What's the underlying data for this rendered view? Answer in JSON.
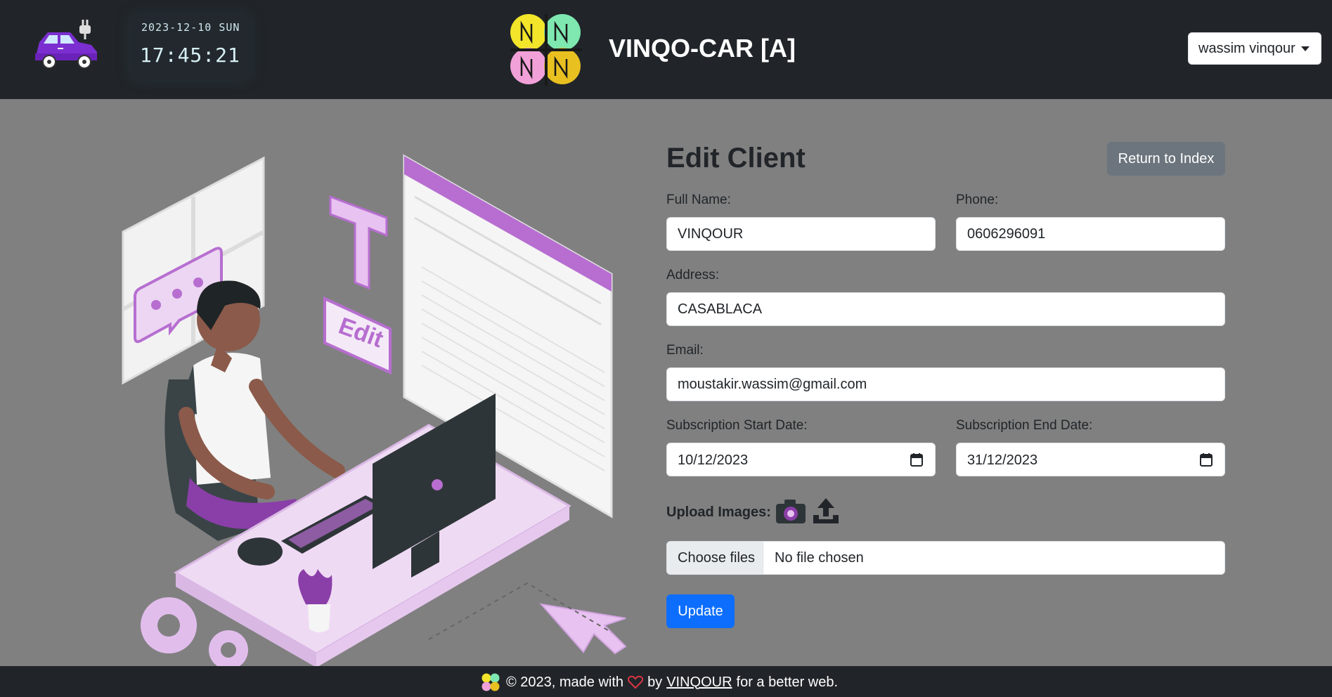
{
  "header": {
    "clock_date": "2023-12-10 SUN",
    "clock_time": "17:45:21",
    "title": "VINQO-CAR [A]",
    "user_menu": "wassim vinqour"
  },
  "form": {
    "title": "Edit Client",
    "return_label": "Return to Index",
    "full_name_label": "Full Name:",
    "full_name_value": "VINQOUR",
    "phone_label": "Phone:",
    "phone_value": "0606296091",
    "address_label": "Address:",
    "address_value": "CASABLACA",
    "email_label": "Email:",
    "email_value": "moustakir.wassim@gmail.com",
    "start_label": "Subscription Start Date:",
    "start_value": "10/12/2023",
    "end_label": "Subscription End Date:",
    "end_value": "31/12/2023",
    "upload_label": "Upload Images:",
    "choose_files": "Choose files",
    "no_file": "No file chosen",
    "update_label": "Update"
  },
  "footer": {
    "pre": "© 2023, made with",
    "by": "by",
    "author": "VINQOUR",
    "post": "for a better web."
  },
  "colors": {
    "header_bg": "#212529",
    "page_bg": "#808080",
    "primary": "#0d6efd",
    "secondary": "#6c757d",
    "accent": "#b76ed0"
  },
  "icons": [
    "car-logo-icon",
    "brand-logo-icon",
    "caret-down-icon",
    "calendar-icon",
    "camera-icon",
    "upload-icon",
    "heart-icon"
  ]
}
